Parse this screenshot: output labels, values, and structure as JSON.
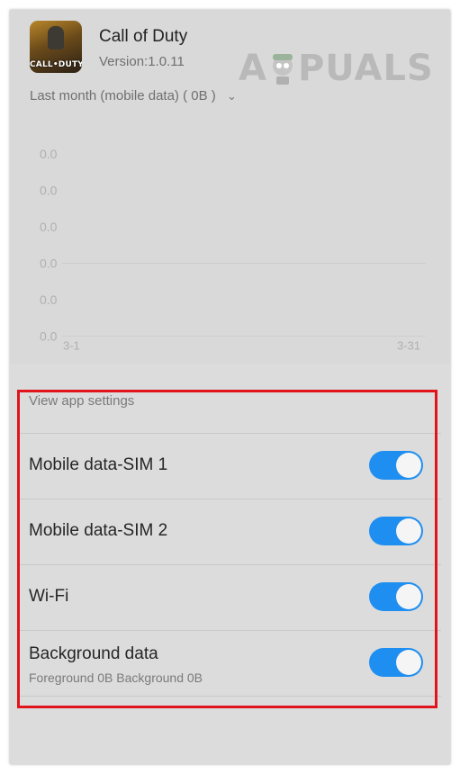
{
  "app": {
    "name": "Call of Duty",
    "version": "Version:1.0.11",
    "icon_text": "CALL•DUTY",
    "icon": "call-of-duty-app-icon"
  },
  "watermark": {
    "left": "A",
    "right": "PUALS",
    "mascot_icon": "appuals-mascot-icon"
  },
  "period": {
    "label": "Last month (mobile data) ( 0B )",
    "icon": "chevron-down-icon"
  },
  "chart_data": {
    "type": "area",
    "x_labels": [
      "3-1",
      "3-31"
    ],
    "y_ticks": [
      "0.0",
      "0.0",
      "0.0",
      "0.0",
      "0.0",
      "0.0"
    ],
    "values": [
      0,
      0
    ],
    "ylim": [
      0,
      0
    ]
  },
  "settings": {
    "header": "View app settings",
    "rows": [
      {
        "label": "Mobile data-SIM 1",
        "enabled": true
      },
      {
        "label": "Mobile data-SIM 2",
        "enabled": true
      },
      {
        "label": "Wi-Fi",
        "enabled": true
      },
      {
        "label": "Background data",
        "sub": "Foreground 0B  Background 0B",
        "enabled": true
      }
    ]
  },
  "colors": {
    "toggle_on": "#1f8ef1",
    "highlight": "#e1141c",
    "background": "#d9d9d9"
  }
}
